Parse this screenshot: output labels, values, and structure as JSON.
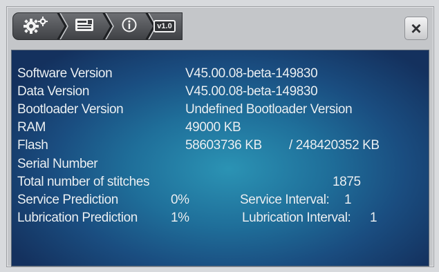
{
  "toolbar": {
    "tabs": [
      {
        "icon": "gears-icon"
      },
      {
        "icon": "machine-card-icon"
      },
      {
        "icon": "info-icon"
      },
      {
        "icon": "version-badge-icon",
        "badge_text": "v1.0"
      }
    ],
    "close_label": "×"
  },
  "info": {
    "software_version": {
      "label": "Software Version",
      "value": "V45.00.08-beta-149830"
    },
    "data_version": {
      "label": "Data Version",
      "value": "V45.00.08-beta-149830"
    },
    "bootloader_version": {
      "label": "Bootloader Version",
      "value": "Undefined Bootloader Version"
    },
    "ram": {
      "label": "RAM",
      "value": "49000 KB"
    },
    "flash": {
      "label": "Flash",
      "value": "58603736 KB",
      "total": "/ 248420352 KB"
    },
    "serial_number": {
      "label": "Serial Number",
      "value": ""
    },
    "stitches": {
      "label": "Total number of stitches",
      "value": "1875"
    },
    "service": {
      "label": "Service Prediction",
      "value": "0%",
      "interval_label": "Service Interval:",
      "interval_value": "1"
    },
    "lubrication": {
      "label": "Lubrication Prediction",
      "value": "1%",
      "interval_label": "Lubrication Interval:",
      "interval_value": "1"
    }
  },
  "colors": {
    "panel_center": "#2b93b4",
    "panel_edge": "#14315e",
    "text": "#eaf1f6"
  }
}
